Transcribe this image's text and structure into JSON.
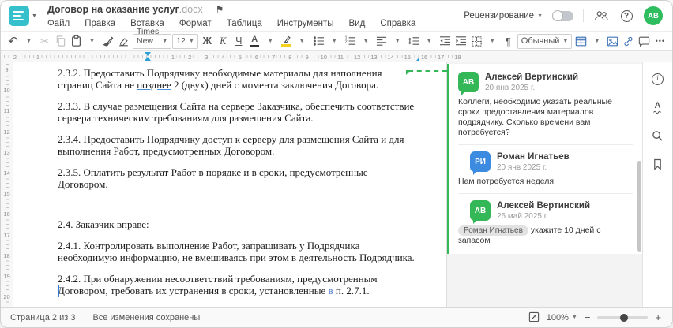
{
  "header": {
    "title": "Договор на оказание услуг",
    "title_ext": ".docx",
    "review_label": "Рецензирование",
    "avatar_initials": "АВ",
    "help_label": "?"
  },
  "menubar": {
    "items": [
      "Файл",
      "Правка",
      "Вставка",
      "Формат",
      "Таблица",
      "Инструменты",
      "Вид",
      "Справка"
    ]
  },
  "toolbar": {
    "font_name": "Times New ...",
    "font_size": "12",
    "bold_label": "Ж",
    "italic_label": "К",
    "underline_label": "Ч",
    "font_color_letter": "А",
    "pilcrow": "¶",
    "style_name": "Обычный",
    "more_label": "•••"
  },
  "ruler": {
    "h_left_labels": [
      "2",
      "1"
    ],
    "h_labels": [
      "1",
      "2",
      "3",
      "4",
      "5",
      "6",
      "7",
      "8",
      "9",
      "10",
      "11",
      "12",
      "13",
      "14",
      "15",
      "16",
      "17",
      "18"
    ],
    "v_labels": [
      "9",
      "10",
      "11",
      "12",
      "13",
      "14",
      "15",
      "16",
      "17",
      "18",
      "19",
      "20"
    ]
  },
  "document": {
    "paragraphs": [
      {
        "gap": "normal",
        "parts": [
          {
            "t": "2.3.2. Предоставить Подрядчику необходимые материалы для наполнения страниц Сайта не ",
            "s": "normal"
          },
          {
            "t": "позднее",
            "s": "underline"
          },
          {
            "t": " 2 (двух) дней с момента заключения Договора.",
            "s": "normal"
          }
        ]
      },
      {
        "gap": "normal",
        "parts": [
          {
            "t": "2.3.3. В случае размещения Сайта на сервере Заказчика, обеспечить соответствие сервера техническим требованиям для размещения Сайта.",
            "s": "normal"
          }
        ]
      },
      {
        "gap": "normal",
        "parts": [
          {
            "t": "2.3.4. Предоставить Подрядчику доступ к серверу для размещения Сайта и для выполнения Работ, предусмотренных Договором.",
            "s": "normal"
          }
        ]
      },
      {
        "gap": "normal",
        "parts": [
          {
            "t": "2.3.5. Оплатить результат Работ в порядке и в сроки, предусмотренные Договором.",
            "s": "normal"
          }
        ]
      },
      {
        "gap": "large",
        "parts": [
          {
            "t": "2.4. Заказчик вправе:",
            "s": "normal"
          }
        ]
      },
      {
        "gap": "normal",
        "parts": [
          {
            "t": "2.4.1. Контролировать выполнение Работ, запрашивать у Подрядчика необходимую информацию, не вмешиваясь при этом в деятельность Подрядчика.",
            "s": "normal"
          }
        ]
      },
      {
        "gap": "normal",
        "parts": [
          {
            "t": "2.4.2. При обнаружении несоответствий требованиям, предусмотренным Договором, требовать их устранения в сроки, установленные ",
            "s": "normal"
          },
          {
            "t": "в",
            "s": "blue"
          },
          {
            "t": " п. 2.7.1.",
            "s": "normal"
          }
        ]
      }
    ]
  },
  "comments": {
    "thread": [
      {
        "initials": "АВ",
        "color": "green",
        "reply": false,
        "name": "Алексей Вертинский",
        "date": "20 янв 2025 г.",
        "body": [
          {
            "type": "text",
            "t": "Коллеги, необходимо указать реальные сроки предоставления материалов подрядчику. Сколько времени вам потребуется?"
          }
        ]
      },
      {
        "initials": "РИ",
        "color": "blue",
        "reply": true,
        "name": "Роман Игнатьев",
        "date": "20 янв 2025 г.",
        "body": [
          {
            "type": "text",
            "t": "Нам потребуется неделя"
          }
        ]
      },
      {
        "initials": "АВ",
        "color": "green",
        "reply": true,
        "name": "Алексей Вертинский",
        "date": "26 май 2025 г.",
        "body": [
          {
            "type": "mention",
            "t": "Роман Игнатьев"
          },
          {
            "type": "text",
            "t": " укажите 10 дней с запасом"
          }
        ]
      }
    ]
  },
  "statusbar": {
    "page_label": "Страница 2 из 3",
    "saved_label": "Все изменения сохранены",
    "zoom_value": "100%",
    "zoom_out": "−",
    "zoom_in": "+"
  },
  "colors": {
    "brand_teal": "#35c0cb",
    "comment_green": "#34b857",
    "reply_blue": "#3d8be0",
    "toolbar_icon_blue": "#4275b8",
    "ruler_marker_blue": "#29a0d6",
    "insert_underline_blue": "#4a90d9",
    "tracked_text_blue": "#4472c4"
  }
}
